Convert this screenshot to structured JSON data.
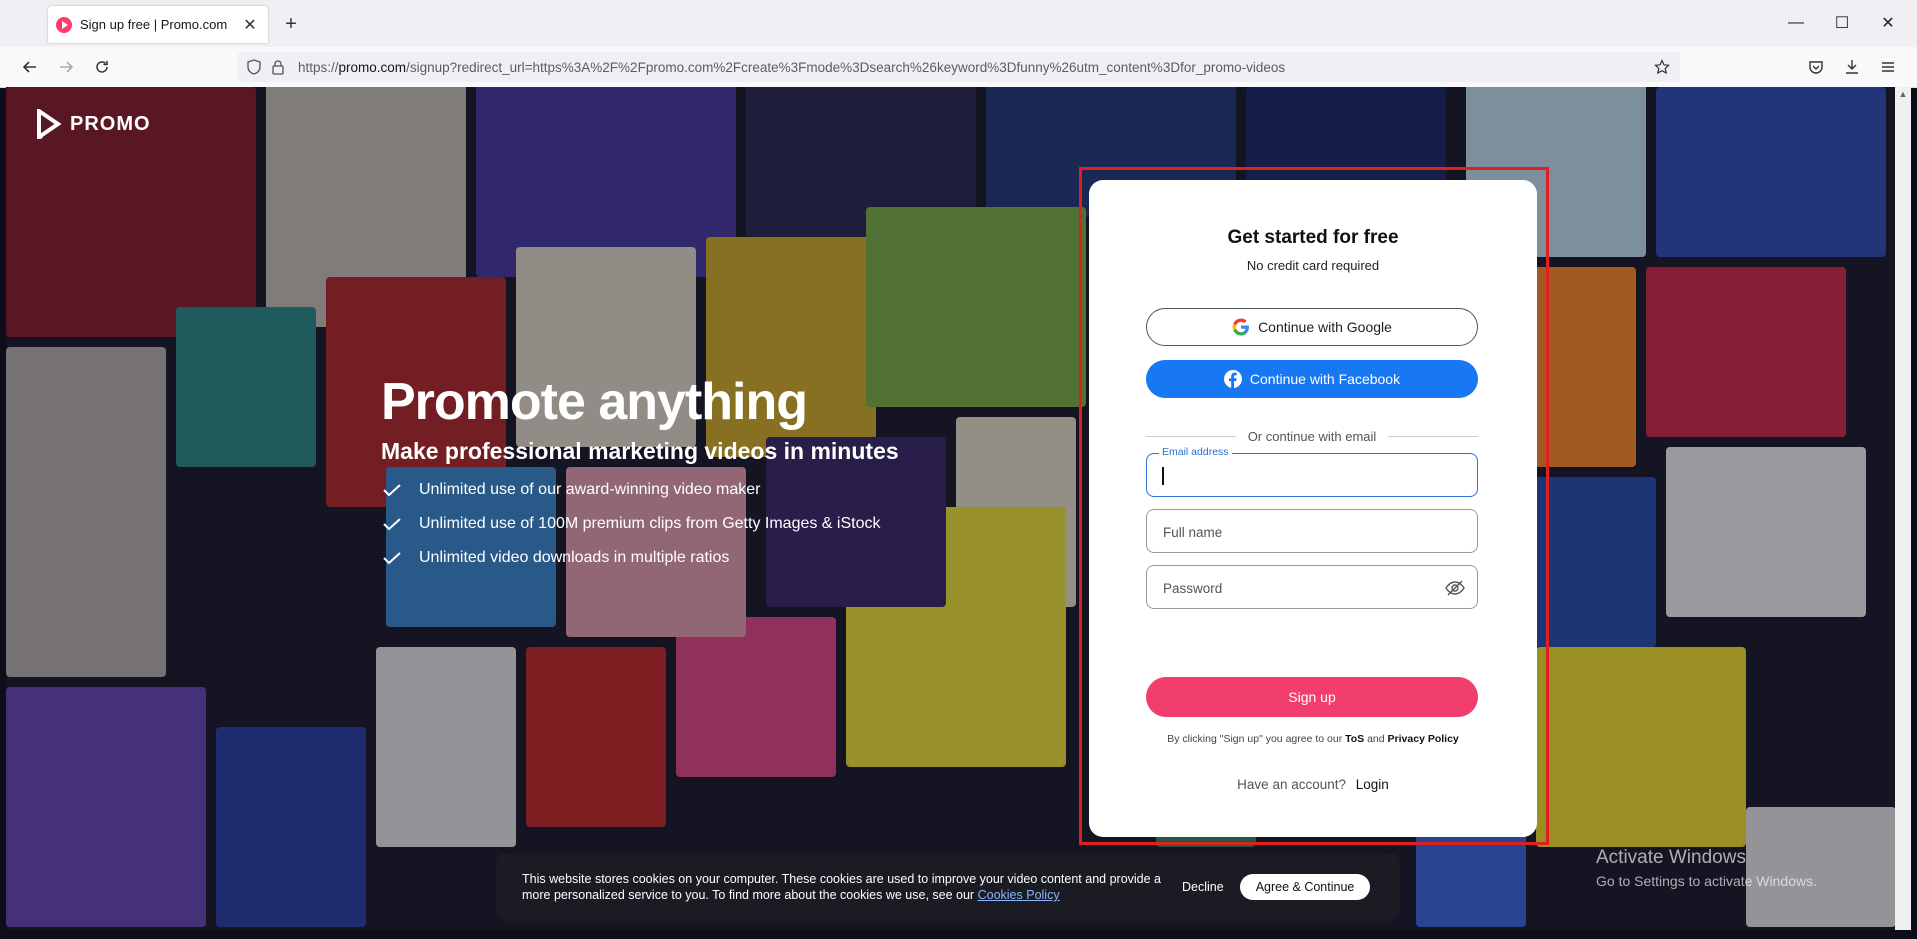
{
  "browser": {
    "tab_title": "Sign up free | Promo.com",
    "url_prefix": "https://",
    "url_domain": "promo.com",
    "url_rest": "/signup?redirect_url=https%3A%2F%2Fpromo.com%2Fcreate%3Fmode%3Dsearch%26keyword%3Dfunny%26utm_content%3Dfor_promo-videos"
  },
  "page": {
    "logo_text": "PROMO",
    "hero_title": "Promote anything",
    "hero_subtitle": "Make professional marketing videos in minutes",
    "features": [
      "Unlimited use of our award-winning video maker",
      "Unlimited use of 100M premium clips from Getty Images & iStock",
      "Unlimited video downloads in multiple ratios"
    ]
  },
  "signup": {
    "title": "Get started for free",
    "subtitle": "No credit card required",
    "google_label": "Continue with Google",
    "facebook_label": "Continue with Facebook",
    "divider": "Or continue with email",
    "email_label": "Email address",
    "email_value": "",
    "fullname_placeholder": "Full name",
    "password_placeholder": "Password",
    "signup_label": "Sign up",
    "terms_prefix": "By clicking \"Sign up\" you agree to our",
    "tos": "ToS",
    "terms_and": "and",
    "privacy": "Privacy Policy",
    "account_prompt": "Have an account?",
    "login_label": "Login"
  },
  "cookie": {
    "text": "This website stores cookies on your computer. These cookies are used to improve your video content and provide a more personalized service to you. To find more about the cookies we use, see our",
    "link": "Cookies Policy",
    "decline": "Decline",
    "agree": "Agree & Continue"
  },
  "windows": {
    "line1": "Activate Windows",
    "line2": "Go to Settings to activate Windows."
  },
  "colors": {
    "brand_pink": "#f23e6d",
    "facebook_blue": "#1877f2",
    "focus_blue": "#2a6fd1",
    "highlight_red": "#e02020"
  }
}
